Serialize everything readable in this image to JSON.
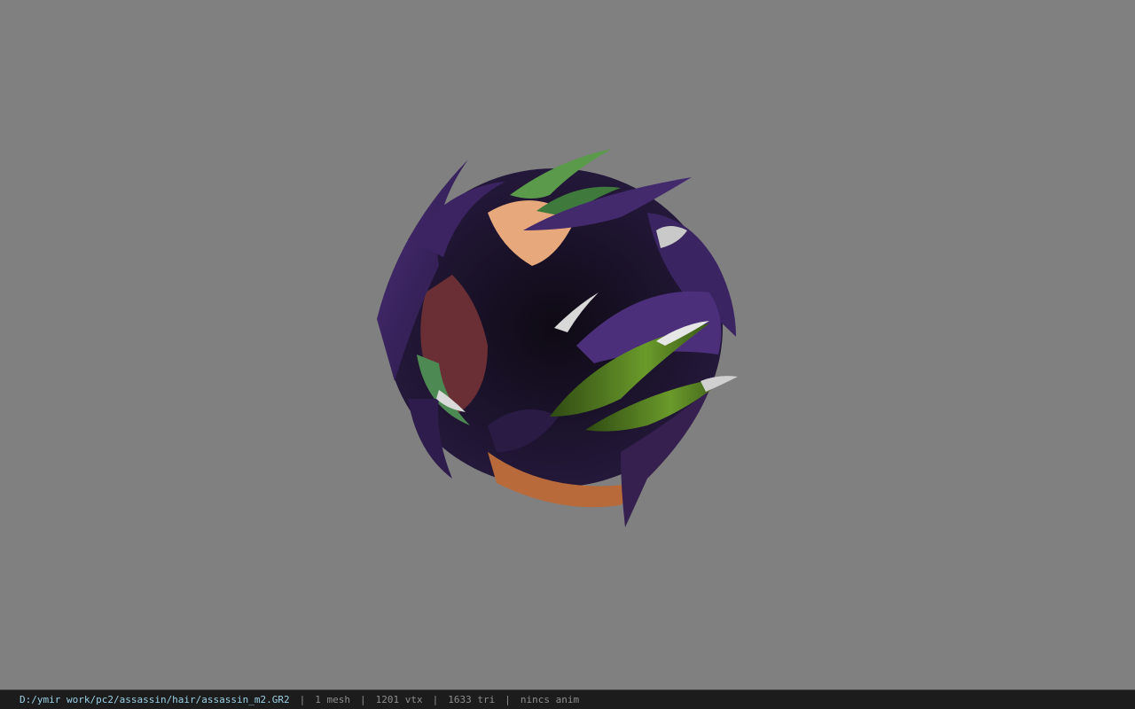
{
  "viewer": {
    "model_icon": "hair-mesh-icon"
  },
  "status": {
    "file_path": "D:/ymir work/pc2/assassin/hair/assassin_m2.GR2",
    "separator": "|",
    "mesh_count": "1 mesh",
    "vertex_count": "1201 vtx",
    "triangle_count": "1633 tri",
    "animation": "nincs anim"
  },
  "colors": {
    "viewport_bg": "#808080",
    "statusbar_bg": "#1c1c1c",
    "path_text": "#9bd0e6",
    "info_text": "#8e8e8e"
  }
}
